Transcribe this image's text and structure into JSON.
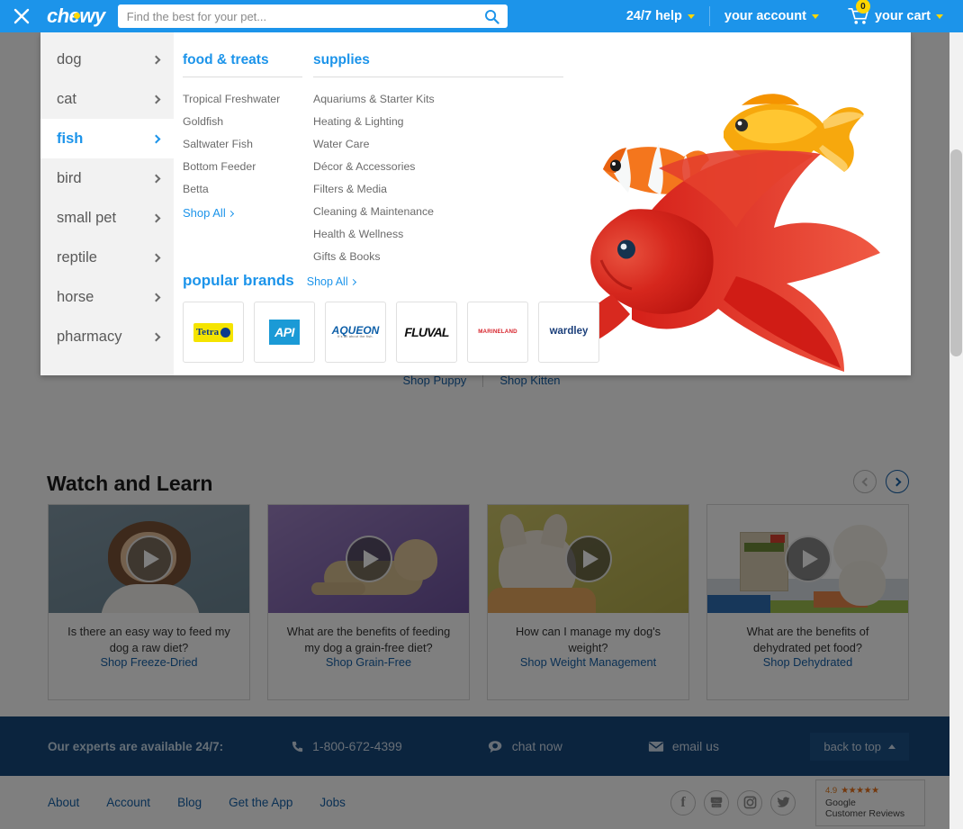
{
  "header": {
    "close_icon": "close-icon",
    "brand": "chewy",
    "search": {
      "placeholder": "Find the best for your pet...",
      "value": "",
      "icon": "search-icon"
    },
    "help_label": "24/7 help",
    "account_label": "your account",
    "cart_label": "your cart",
    "cart_count": "0"
  },
  "megamenu": {
    "side_items": [
      {
        "label": "dog",
        "active": false
      },
      {
        "label": "cat",
        "active": false
      },
      {
        "label": "fish",
        "active": true
      },
      {
        "label": "bird",
        "active": false
      },
      {
        "label": "small pet",
        "active": false
      },
      {
        "label": "reptile",
        "active": false
      },
      {
        "label": "horse",
        "active": false
      },
      {
        "label": "pharmacy",
        "active": false
      }
    ],
    "columns": [
      {
        "title": "food & treats",
        "links": [
          "Tropical Freshwater",
          "Goldfish",
          "Saltwater Fish",
          "Bottom Feeder",
          "Betta"
        ],
        "shop_all": "Shop All"
      },
      {
        "title": "supplies",
        "links": [
          "Aquariums & Starter Kits",
          "Heating & Lighting",
          "Water Care",
          "Décor & Accessories",
          "Filters & Media",
          "Cleaning & Maintenance",
          "Health & Wellness",
          "Gifts & Books"
        ],
        "shop_all": ""
      }
    ],
    "brands": {
      "title": "popular brands",
      "shop_all": "Shop All",
      "items": [
        {
          "name": "Tetra",
          "style": "tetra"
        },
        {
          "name": "API",
          "style": "api"
        },
        {
          "name": "AQUEON",
          "style": "aqueon",
          "tagline": "It's all about the fish."
        },
        {
          "name": "FLUVAL",
          "style": "fluval"
        },
        {
          "name": "MARINELAND",
          "style": "marineland"
        },
        {
          "name": "wardley",
          "style": "wardley"
        }
      ]
    }
  },
  "hero": {
    "shop_puppy": "Shop Puppy",
    "shop_kitten": "Shop Kitten"
  },
  "watch_and_learn": {
    "title": "Watch and Learn",
    "prev_icon": "chevron-left-icon",
    "next_icon": "chevron-right-icon",
    "cards": [
      {
        "question": "Is there an easy way to feed my dog a raw diet?",
        "link": "Shop Freeze-Dried",
        "thumb_color_a": "#7d94a3",
        "thumb_color_b": "#6c8694"
      },
      {
        "question": "What are the benefits of feeding my dog a grain-free diet?",
        "link": "Shop Grain-Free",
        "thumb_color_a": "#8f72b5",
        "thumb_color_b": "#7b5ea3"
      },
      {
        "question": "How can I manage my dog's weight?",
        "link": "Shop Weight Management",
        "thumb_color_a": "#c8c060",
        "thumb_color_b": "#b6ae4e"
      },
      {
        "question": "What are the benefits of dehydrated pet food?",
        "link": "Shop Dehydrated",
        "thumb_color_a": "#e3e0d6",
        "thumb_color_b": "#d5d2c4"
      }
    ]
  },
  "footer": {
    "experts_label": "Our experts are available 24/7:",
    "phone": "1-800-672-4399",
    "phone_icon": "phone-icon",
    "chat": "chat now",
    "chat_icon": "chat-icon",
    "email": "email us",
    "email_icon": "envelope-icon",
    "back_to_top": "back to top",
    "nav_links": [
      "About",
      "Account",
      "Blog",
      "Get the App",
      "Jobs"
    ],
    "social": [
      {
        "name": "facebook-icon",
        "glyph": "f"
      },
      {
        "name": "youtube-icon",
        "glyph": "You"
      },
      {
        "name": "instagram-icon",
        "glyph": "◉"
      },
      {
        "name": "twitter-icon",
        "glyph": "t"
      }
    ],
    "google_reviews": {
      "score": "4.9",
      "stars": "★★★★★",
      "line1": "Google",
      "line2": "Customer Reviews"
    }
  },
  "colors": {
    "brand_blue": "#1c94ea",
    "accent_yellow": "#fdd700",
    "footer_blue": "#17487c",
    "link_blue": "#1560a8"
  }
}
